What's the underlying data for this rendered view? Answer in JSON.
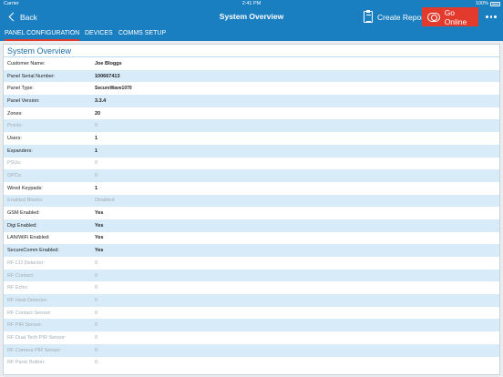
{
  "status_bar": {
    "carrier": "Carrier",
    "time": "2:41 PM",
    "battery": "100%"
  },
  "nav": {
    "back_label": "Back",
    "title": "System Overview",
    "create_report_label": "Create Report",
    "go_online_label": "Go Online"
  },
  "tabs": [
    {
      "label": "PANEL CONFIGURATION",
      "active": true
    },
    {
      "label": "DEVICES",
      "active": false
    },
    {
      "label": "COMMS SETUP",
      "active": false
    }
  ],
  "panel": {
    "title": "System Overview",
    "rows": [
      {
        "label": "Customer Name:",
        "value": "Joe Bloggs",
        "enabled": true
      },
      {
        "label": "Panel Serial Number:",
        "value": "100667413",
        "enabled": true
      },
      {
        "label": "Panel Type:",
        "value": "SecureWave1070",
        "enabled": true
      },
      {
        "label": "Panel Version:",
        "value": "3.3.4",
        "enabled": true
      },
      {
        "label": "Zones:",
        "value": "20",
        "enabled": true
      },
      {
        "label": "Points:",
        "value": "0",
        "enabled": false
      },
      {
        "label": "Users:",
        "value": "1",
        "enabled": true
      },
      {
        "label": "Expanders:",
        "value": "1",
        "enabled": true
      },
      {
        "label": "PSUs:",
        "value": "0",
        "enabled": false
      },
      {
        "label": "OPCs:",
        "value": "0",
        "enabled": false
      },
      {
        "label": "Wired Keypads:",
        "value": "1",
        "enabled": true
      },
      {
        "label": "Enabled Blocks:",
        "value": "Disabled",
        "enabled": false
      },
      {
        "label": "GSM Enabled:",
        "value": "Yes",
        "enabled": true
      },
      {
        "label": "Digi Enabled:",
        "value": "Yes",
        "enabled": true
      },
      {
        "label": "LAN/WiFi Enabled:",
        "value": "Yes",
        "enabled": true
      },
      {
        "label": "SecureComm Enabled:",
        "value": "Yes",
        "enabled": true
      },
      {
        "label": "RF CO Detector:",
        "value": "0",
        "enabled": false
      },
      {
        "label": "RF Contact:",
        "value": "0",
        "enabled": false
      },
      {
        "label": "RF Echo:",
        "value": "0",
        "enabled": false
      },
      {
        "label": "RF Heat Detector:",
        "value": "0",
        "enabled": false
      },
      {
        "label": "RF Contact Sensor:",
        "value": "0",
        "enabled": false
      },
      {
        "label": "RF PIR Sensor:",
        "value": "0",
        "enabled": false
      },
      {
        "label": "RF Dual Tech PIR Sensor:",
        "value": "0",
        "enabled": false
      },
      {
        "label": "RF Camera PIR Sensor:",
        "value": "0",
        "enabled": false
      },
      {
        "label": "RF Panic Button:",
        "value": "0",
        "enabled": false
      }
    ]
  },
  "colors": {
    "primary": "#1a7fc1",
    "accent": "#e23b2e",
    "row_alt": "#d7ebf8"
  }
}
